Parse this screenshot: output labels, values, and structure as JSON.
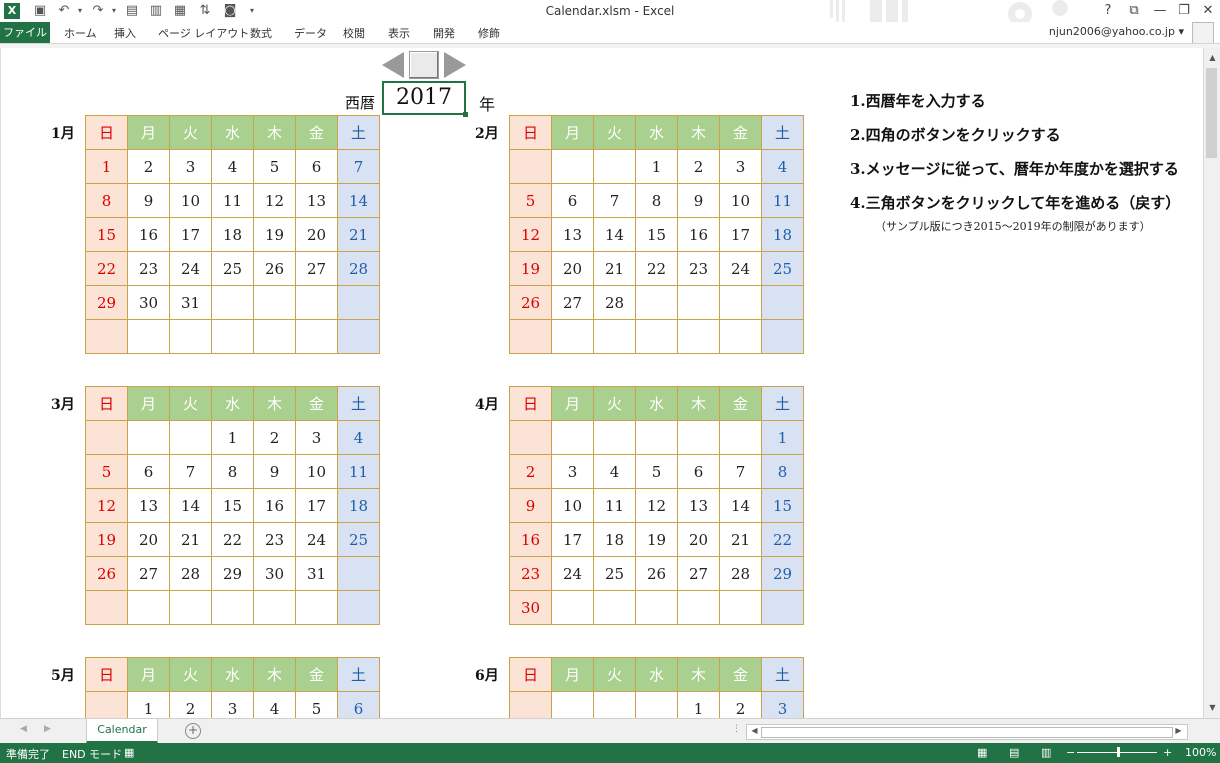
{
  "window": {
    "title": "Calendar.xlsm - Excel",
    "logo": "X",
    "controls": [
      "?",
      "⧉",
      "—",
      "❐",
      "✕"
    ]
  },
  "quick_access": [
    "save-icon",
    "undo-icon",
    "redo-icon",
    "form-icon",
    "table-icon",
    "grid-icon",
    "sort-icon",
    "camera-icon"
  ],
  "ribbon": {
    "file": "ファイル",
    "tabs": [
      "ホーム",
      "挿入",
      "ページ レイアウト",
      "数式",
      "データ",
      "校閲",
      "表示",
      "開発",
      "修飾"
    ],
    "user": "njun2006@yahoo.co.jp"
  },
  "sheet": {
    "year_label": "西暦",
    "year_value": "2017",
    "year_suffix": "年",
    "instructions": [
      "1.西暦年を入力する",
      "2.四角のボタンをクリックする",
      "3.メッセージに従って、暦年か年度かを選択する",
      "4.三角ボタンをクリックして年を進める（戻す）"
    ],
    "note": "（サンプル版につき2015～2019年の制限があります）",
    "weekdays": [
      "日",
      "月",
      "火",
      "水",
      "木",
      "金",
      "土"
    ],
    "months": [
      {
        "label": "1月",
        "weeks": [
          [
            "1",
            "2",
            "3",
            "4",
            "5",
            "6",
            "7"
          ],
          [
            "8",
            "9",
            "10",
            "11",
            "12",
            "13",
            "14"
          ],
          [
            "15",
            "16",
            "17",
            "18",
            "19",
            "20",
            "21"
          ],
          [
            "22",
            "23",
            "24",
            "25",
            "26",
            "27",
            "28"
          ],
          [
            "29",
            "30",
            "31",
            "",
            "",
            "",
            ""
          ],
          [
            "",
            "",
            "",
            "",
            "",
            "",
            ""
          ]
        ]
      },
      {
        "label": "2月",
        "weeks": [
          [
            "",
            "",
            "",
            "1",
            "2",
            "3",
            "4"
          ],
          [
            "5",
            "6",
            "7",
            "8",
            "9",
            "10",
            "11"
          ],
          [
            "12",
            "13",
            "14",
            "15",
            "16",
            "17",
            "18"
          ],
          [
            "19",
            "20",
            "21",
            "22",
            "23",
            "24",
            "25"
          ],
          [
            "26",
            "27",
            "28",
            "",
            "",
            "",
            ""
          ],
          [
            "",
            "",
            "",
            "",
            "",
            "",
            ""
          ]
        ]
      },
      {
        "label": "3月",
        "weeks": [
          [
            "",
            "",
            "",
            "1",
            "2",
            "3",
            "4"
          ],
          [
            "5",
            "6",
            "7",
            "8",
            "9",
            "10",
            "11"
          ],
          [
            "12",
            "13",
            "14",
            "15",
            "16",
            "17",
            "18"
          ],
          [
            "19",
            "20",
            "21",
            "22",
            "23",
            "24",
            "25"
          ],
          [
            "26",
            "27",
            "28",
            "29",
            "30",
            "31",
            ""
          ],
          [
            "",
            "",
            "",
            "",
            "",
            "",
            ""
          ]
        ]
      },
      {
        "label": "4月",
        "weeks": [
          [
            "",
            "",
            "",
            "",
            "",
            "",
            "1"
          ],
          [
            "2",
            "3",
            "4",
            "5",
            "6",
            "7",
            "8"
          ],
          [
            "9",
            "10",
            "11",
            "12",
            "13",
            "14",
            "15"
          ],
          [
            "16",
            "17",
            "18",
            "19",
            "20",
            "21",
            "22"
          ],
          [
            "23",
            "24",
            "25",
            "26",
            "27",
            "28",
            "29"
          ],
          [
            "30",
            "",
            "",
            "",
            "",
            "",
            ""
          ]
        ]
      },
      {
        "label": "5月",
        "weeks": [
          [
            "",
            "1",
            "2",
            "3",
            "4",
            "5",
            "6"
          ]
        ]
      },
      {
        "label": "6月",
        "weeks": [
          [
            "",
            "",
            "",
            "",
            "1",
            "2",
            "3"
          ]
        ]
      }
    ]
  },
  "sheet_tabs": {
    "active": "Calendar",
    "add": "+"
  },
  "status": {
    "ready": "準備完了",
    "mode": "END モード",
    "zoom": "100%",
    "zoom_minus": "−",
    "zoom_plus": "+"
  }
}
